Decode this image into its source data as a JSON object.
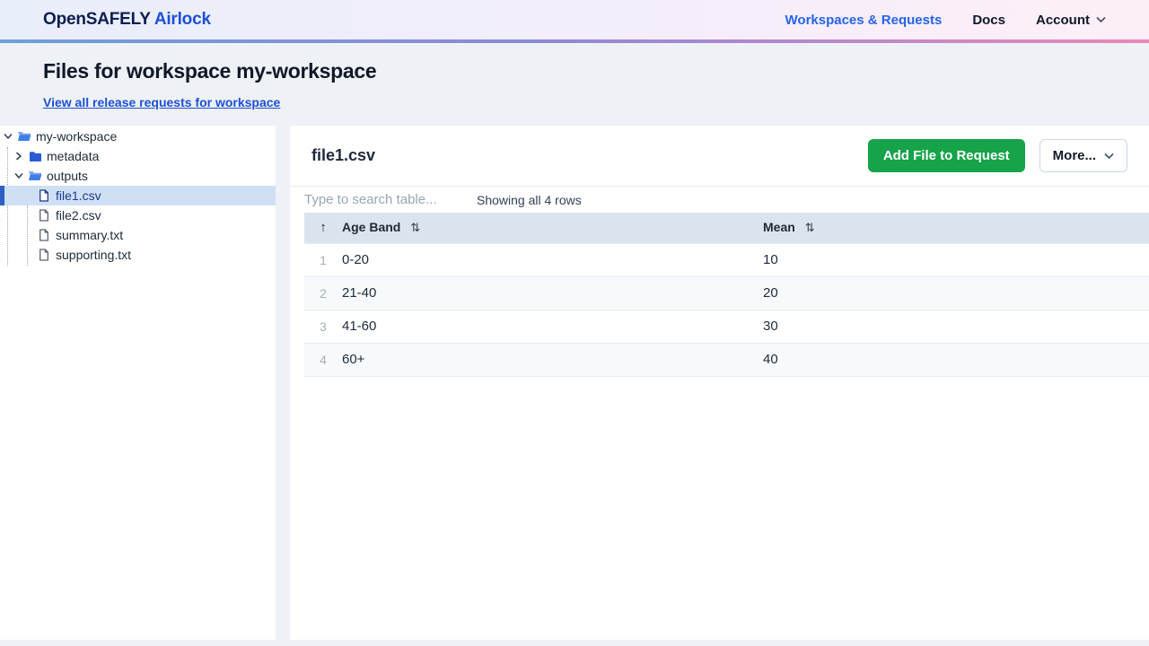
{
  "navbar": {
    "brand_primary": "OpenSAFELY",
    "brand_secondary": "Airlock",
    "link_workspaces": "Workspaces & Requests",
    "link_docs": "Docs",
    "account_label": "Account"
  },
  "header": {
    "title": "Files for workspace my-workspace",
    "release_link": "View all release requests for workspace"
  },
  "sidebar": {
    "tree": [
      {
        "label": "my-workspace",
        "type": "folder",
        "state": "expanded",
        "depth": 0,
        "selected": false
      },
      {
        "label": "metadata",
        "type": "folder",
        "state": "collapsed",
        "depth": 1,
        "selected": false
      },
      {
        "label": "outputs",
        "type": "folder",
        "state": "expanded",
        "depth": 1,
        "selected": false
      },
      {
        "label": "file1.csv",
        "type": "file",
        "depth": 2,
        "selected": true
      },
      {
        "label": "file2.csv",
        "type": "file",
        "depth": 2,
        "selected": false
      },
      {
        "label": "summary.txt",
        "type": "file",
        "depth": 2,
        "selected": false
      },
      {
        "label": "supporting.txt",
        "type": "file",
        "depth": 2,
        "selected": false
      }
    ]
  },
  "main": {
    "file_title": "file1.csv",
    "add_file_button": "Add File to Request",
    "more_button": "More...",
    "search_placeholder": "Type to search table...",
    "rows_status": "Showing all 4 rows",
    "table": {
      "sorted_ascending_icon": "↑",
      "sort_icon": "⇅",
      "columns": [
        "Age Band",
        "Mean"
      ],
      "rows": [
        {
          "num": "1",
          "age_band": "0-20",
          "mean": "10"
        },
        {
          "num": "2",
          "age_band": "21-40",
          "mean": "20"
        },
        {
          "num": "3",
          "age_band": "41-60",
          "mean": "30"
        },
        {
          "num": "4",
          "age_band": "60+",
          "mean": "40"
        }
      ]
    }
  },
  "colors": {
    "brand_navy": "#0b1e4e",
    "brand_blue": "#1d4fd7",
    "nav_link_blue": "#2563eb",
    "header_link_blue": "#1d4ed8",
    "button_green": "#16a34a",
    "selected_row_bg": "#cfe0f5",
    "selected_bar_blue": "#2e5fc4",
    "table_header_bg": "#dbe4ee",
    "nav_gradient": [
      "#6f9edc",
      "#8f88d8",
      "#ea89b8"
    ]
  }
}
